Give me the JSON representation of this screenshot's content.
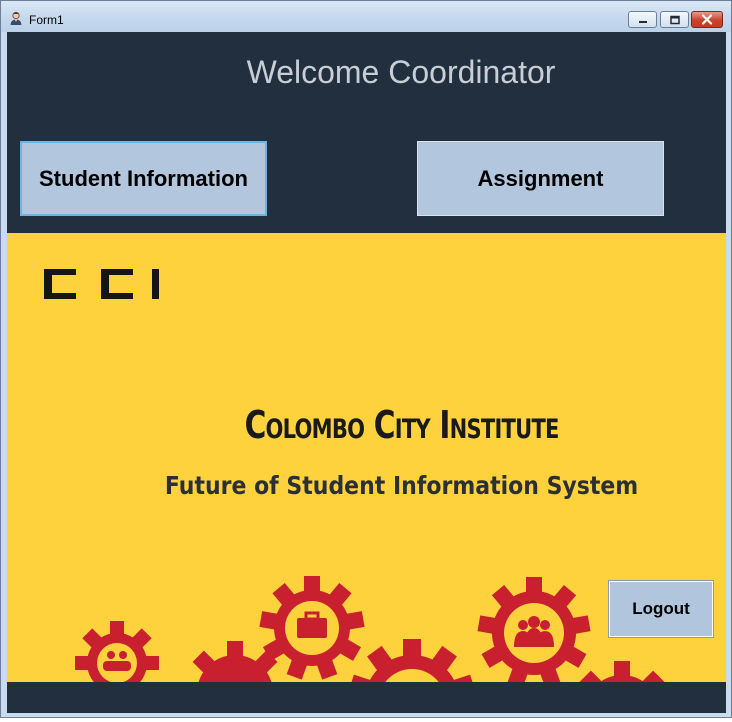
{
  "window": {
    "title": "Form1",
    "controls": {
      "minimize": "minimize-icon",
      "maximize": "maximize-icon",
      "close": "close-icon"
    }
  },
  "header": {
    "welcome_text": "Welcome Coordinator"
  },
  "nav": {
    "student_information_label": "Student Information",
    "assignment_label": "Assignment"
  },
  "banner": {
    "logo_text": "CCI",
    "institute_name": "Colombo City Institute",
    "tagline": "Future of Student Information System"
  },
  "actions": {
    "logout_label": "Logout"
  },
  "colors": {
    "panel_dark": "#222f3f",
    "button_fill": "#b2c6dd",
    "banner_yellow": "#fdd23d",
    "gear_red": "#c9202f",
    "header_text": "#c7ced6"
  }
}
